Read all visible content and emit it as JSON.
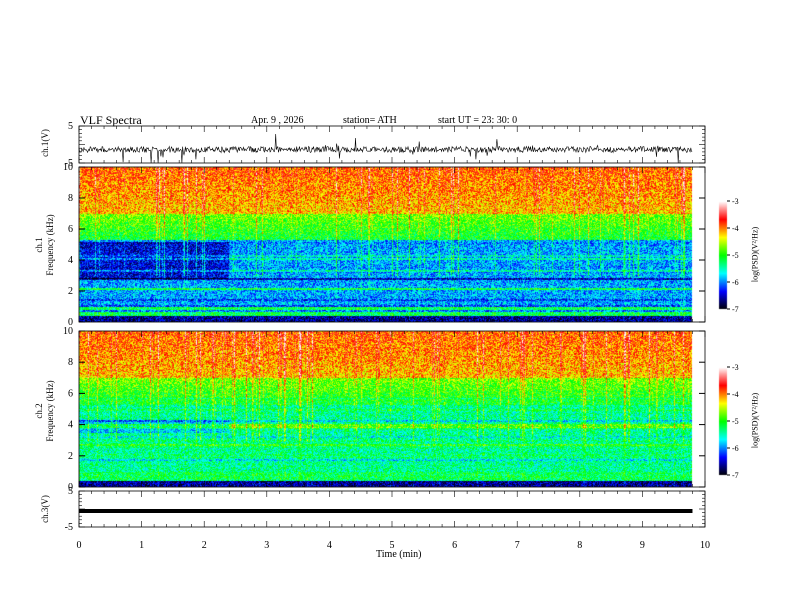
{
  "header": {
    "title": "VLF  Spectra",
    "date": "Apr. 9  , 2026",
    "station": "station= ATH",
    "start": "start  UT  =    23: 30: 0"
  },
  "chart_data": {
    "type": "heatmap",
    "xlabel": "Time  (min)",
    "xlim": [
      0,
      10
    ],
    "xticks": [
      "0",
      "1",
      "2",
      "3",
      "4",
      "5",
      "6",
      "7",
      "8",
      "9",
      "10"
    ],
    "data_end_min": 9.8,
    "colormap": [
      "#000000",
      "#0000ff",
      "#00ffff",
      "#00ff00",
      "#ffff00",
      "#ff0000",
      "#ffffff"
    ],
    "panels": [
      {
        "name": "ch1-waveform",
        "ylabel": "ch.1(V)",
        "ylim": [
          -5,
          5
        ],
        "yticks": [
          "5",
          "-5"
        ],
        "type": "line"
      },
      {
        "name": "ch1-spectrogram",
        "ylabel": "ch.1\nFrequency  (kHz)",
        "ylabel_lines": [
          "ch.1",
          "Frequency  (kHz)"
        ],
        "ylim": [
          0,
          10
        ],
        "yticks": [
          "10",
          "8",
          "6",
          "4",
          "2",
          "0"
        ],
        "colorbar": {
          "label": "log(PSD)(V²/Hz)",
          "range": [
            -7,
            -3
          ],
          "ticks": [
            "-3",
            "-4",
            "-5",
            "-6",
            "-7"
          ]
        }
      },
      {
        "name": "ch2-spectrogram",
        "ylabel_lines": [
          "ch.2",
          "Frequency  (kHz)"
        ],
        "ylim": [
          0,
          10
        ],
        "yticks": [
          "10",
          "8",
          "6",
          "4",
          "2",
          "0"
        ],
        "colorbar": {
          "label": "log(PSD)(V²/Hz)",
          "range": [
            -7,
            -3
          ],
          "ticks": [
            "-3",
            "-4",
            "-5",
            "-6",
            "-7"
          ]
        }
      },
      {
        "name": "ch3-waveform",
        "ylabel": "ch.3(V)",
        "ylim": [
          -5,
          5
        ],
        "yticks": [
          "5",
          "-5"
        ],
        "type": "line",
        "level": 0
      }
    ]
  }
}
